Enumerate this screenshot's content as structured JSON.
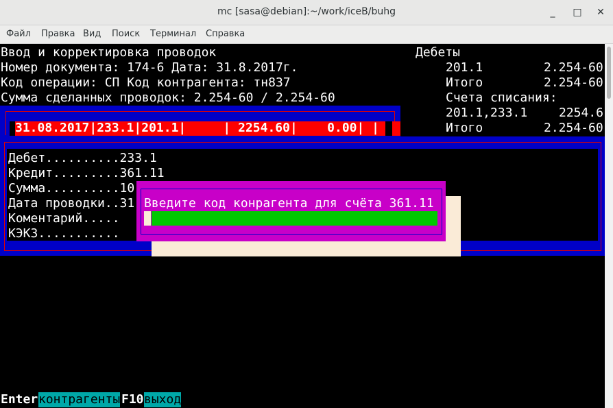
{
  "window": {
    "title": "mc [sasa@debian]:~/work/iceB/buhg",
    "buttons": {
      "minimize": "_",
      "maximize": "□",
      "close": "✕"
    }
  },
  "menu": [
    "Файл",
    "Правка",
    "Вид",
    "Поиск",
    "Терминал",
    "Справка"
  ],
  "header": {
    "line1": "Ввод и корректировка проводок",
    "line2": "Номер документа: 174-6 Дата: 31.8.2017г.",
    "line3": "Код операции: СП Код контрагента: тн837",
    "line4": "Сумма сделанных проводок: 2.254-60 / 2.254-60"
  },
  "right_panel": {
    "debets_title": "Дебеты",
    "debet_account": "201.1",
    "debet_amount": "2.254-60",
    "itogo_label": "Итого",
    "itogo_amount": "2.254-60",
    "writeoff_title": "Счета списания:",
    "writeoff_accounts": "201.1,233.1",
    "writeoff_amount": "2254.6",
    "itogo2_label": "Итого",
    "itogo2_amount": "2.254-60"
  },
  "entry_row": "31.08.2017|233.1|201.1|     | 2254.60|    0.00| |",
  "details": {
    "debet": "Дебет..........233.1",
    "kredit": "Кредит.........361.11",
    "summa": "Сумма..........10",
    "data": "Дата проводки..31",
    "komment": "Коментарий.....",
    "kekz": "КЭКЗ..........."
  },
  "dialog": {
    "prompt": "Введите код конрагента для счёта 361.11",
    "input_value": ""
  },
  "colors": {
    "blue": "#0000c8",
    "red": "#ff0000",
    "magenta": "#c800c8",
    "green": "#00c800",
    "cyan": "#00a8a8",
    "cream": "#faebd7"
  },
  "footer": [
    {
      "key": "Enter",
      "label": "контрагенты"
    },
    {
      "key": "F10",
      "label": "выход"
    }
  ]
}
